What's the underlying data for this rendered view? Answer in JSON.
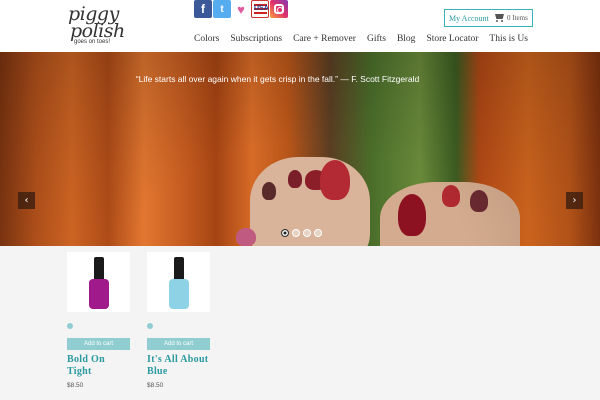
{
  "logo": {
    "line1": "piggy",
    "line2": "polish",
    "tagline": "goes on toes!"
  },
  "social": [
    {
      "name": "facebook-icon",
      "glyph": "f"
    },
    {
      "name": "twitter-icon",
      "glyph": "t"
    },
    {
      "name": "cruelty-free-icon",
      "glyph": "♥"
    },
    {
      "name": "made-in-usa-icon",
      "glyph": "USA"
    },
    {
      "name": "instagram-icon",
      "glyph": ""
    }
  ],
  "account": {
    "my_account": "My Account",
    "cart_items": "0 Items"
  },
  "nav": [
    "Colors",
    "Subscriptions",
    "Care + Remover",
    "Gifts",
    "Blog",
    "Store Locator",
    "This is Us"
  ],
  "hero": {
    "quote": "“Life starts all over again when it gets crisp in the fall.” — F. Scott Fitzgerald",
    "prev": "‹",
    "next": "›",
    "slides": 4,
    "active_slide": 1
  },
  "products": [
    {
      "name": "Bold On Tight",
      "price": "$8.50",
      "button": "Add to cart",
      "color": "#a01a8c"
    },
    {
      "name": "It's All About Blue",
      "price": "$8.50",
      "button": "Add to cart",
      "color": "#8ed2e6"
    }
  ],
  "colors": {
    "accent": "#2a9aa0",
    "button": "#8fcdd0"
  }
}
